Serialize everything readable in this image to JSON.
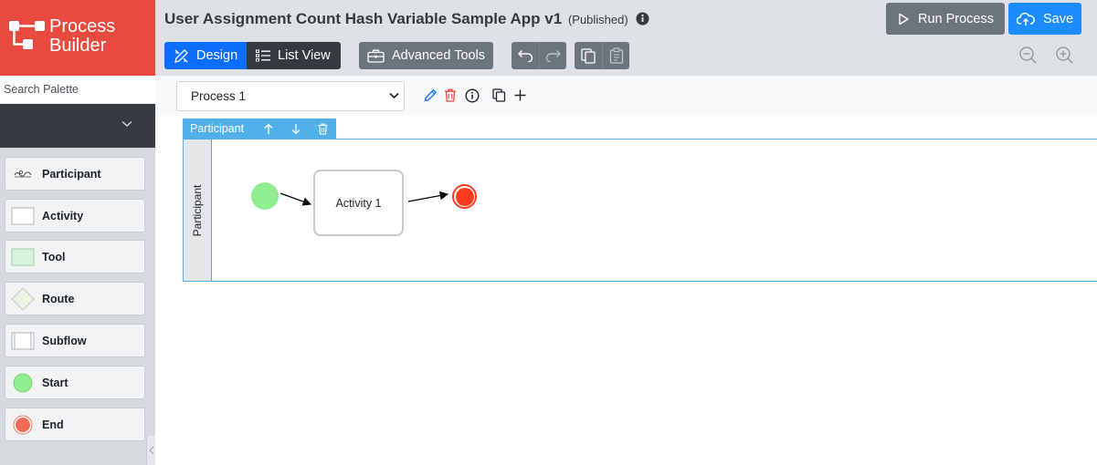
{
  "app": {
    "logo_line1": "Process",
    "logo_line2": "Builder",
    "brand_color": "#e84a3f"
  },
  "palette": {
    "search_placeholder": "Search Palette",
    "items": [
      {
        "label": "Participant",
        "icon": "participant-icon"
      },
      {
        "label": "Activity",
        "icon": "activity-icon"
      },
      {
        "label": "Tool",
        "icon": "tool-icon"
      },
      {
        "label": "Route",
        "icon": "route-icon"
      },
      {
        "label": "Subflow",
        "icon": "subflow-icon"
      },
      {
        "label": "Start",
        "icon": "start-icon"
      },
      {
        "label": "End",
        "icon": "end-icon"
      }
    ]
  },
  "header": {
    "title": "User Assignment Count Hash Variable Sample App v1",
    "status": "(Published)",
    "run_label": "Run Process",
    "save_label": "Save",
    "design_label": "Design",
    "list_view_label": "List View",
    "advanced_tools_label": "Advanced Tools"
  },
  "canvas": {
    "process_select_value": "Process 1",
    "lane_tag_label": "Participant",
    "lane_title": "Participant",
    "nodes": {
      "activity_label": "Activity 1"
    }
  },
  "colors": {
    "primary": "#0d6efd",
    "save": "#1a8cff",
    "secondary": "#6c757d",
    "dark": "#343a40",
    "lane_accent": "#4fb0ea",
    "start_fill": "#90ee90",
    "end_fill": "#ff3b1f",
    "delete": "#e84a3f"
  }
}
